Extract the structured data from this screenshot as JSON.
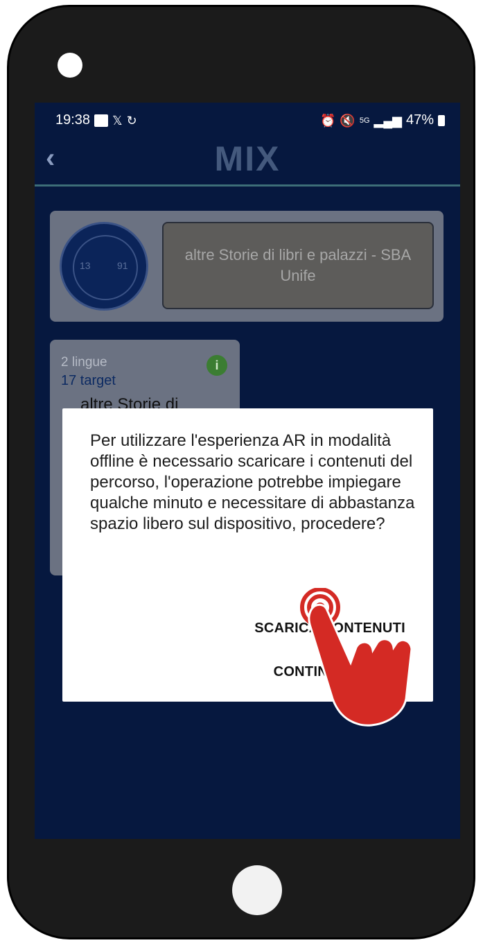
{
  "status_bar": {
    "time": "19:38",
    "network": "5G",
    "battery": "47%",
    "icons": [
      "gallery-icon",
      "x-logo-icon",
      "sync-icon",
      "alarm-icon",
      "mute-icon",
      "signal-icon",
      "battery-icon"
    ]
  },
  "app_bar": {
    "title": "MIX",
    "back_icon": "chevron-left-icon"
  },
  "featured": {
    "logo_numbers": [
      "13",
      "91"
    ],
    "banner_text": "altre Storie di libri e palazzi - SBA Unife"
  },
  "route_card": {
    "languages": "2 lingue",
    "targets": "17 target",
    "title_partial": "altre Storie di"
  },
  "dialog": {
    "message": "Per utilizzare l'esperienza AR in modalità offline è necessario scaricare i contenuti del percorso, l'operazione potrebbe impiegare qualche minuto e necessitare di abbastanza spazio libero sul dispositivo, procedere?",
    "buttons": {
      "download": "SCARICA CONTENUTI",
      "continue": "CONTINUA ONLINE"
    }
  },
  "colors": {
    "screen_bg": "#06183f",
    "card_bg": "#6b7282",
    "tap_red": "#d42a24",
    "accent_line": "#3d6e78"
  }
}
